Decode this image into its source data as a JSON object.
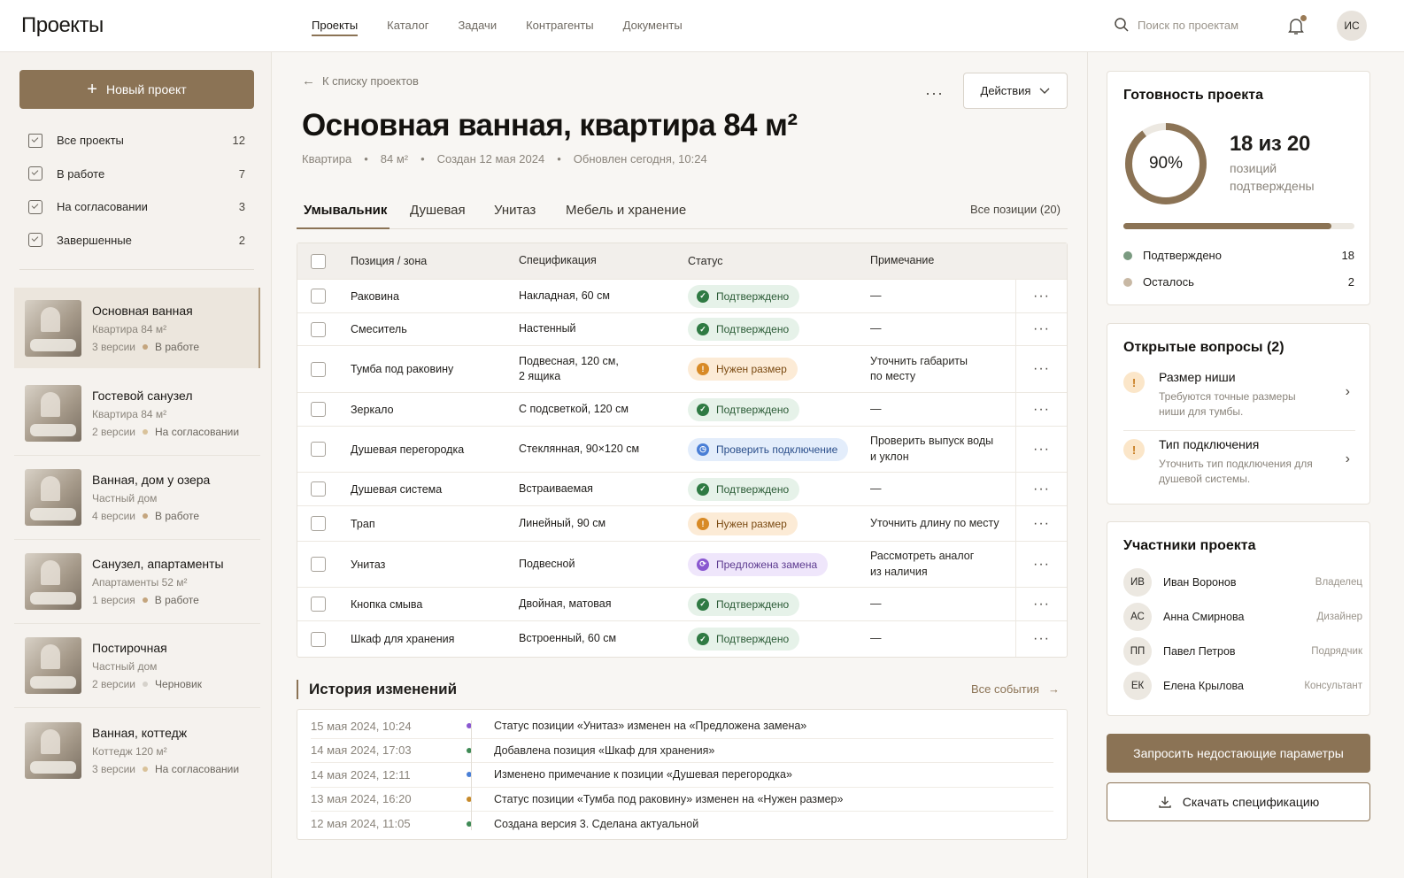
{
  "app": {
    "title": "Проекты"
  },
  "nav": [
    "Проекты",
    "Каталог",
    "Задачи",
    "Контрагенты",
    "Документы"
  ],
  "search": {
    "placeholder": "Поиск по проектам"
  },
  "user": {
    "initials": "ИС"
  },
  "sidebar": {
    "new_project": "Новый проект",
    "filters": [
      {
        "label": "Все проекты",
        "count": "12"
      },
      {
        "label": "В работе",
        "count": "7"
      },
      {
        "label": "На согласовании",
        "count": "3"
      },
      {
        "label": "Завершенные",
        "count": "2"
      }
    ],
    "projects": [
      {
        "name": "Основная ванная",
        "type": "Квартира 84 м²",
        "versions": "3 версии",
        "status": "В работе",
        "status_color": "#c4a57e"
      },
      {
        "name": "Гостевой санузел",
        "type": "Квартира 84 м²",
        "versions": "2 версии",
        "status": "На согласовании",
        "status_color": "#d9c29a"
      },
      {
        "name": "Ванная, дом у озера",
        "type": "Частный дом",
        "versions": "4 версии",
        "status": "В работе",
        "status_color": "#c4a57e"
      },
      {
        "name": "Санузел, апартаменты",
        "type": "Апартаменты 52 м²",
        "versions": "1 версия",
        "status": "В работе",
        "status_color": "#c4a57e"
      },
      {
        "name": "Постирочная",
        "type": "Частный дом",
        "versions": "2 версии",
        "status": "Черновик",
        "status_color": "#d6d2cb"
      },
      {
        "name": "Ванная, коттедж",
        "type": "Коттедж 120 м²",
        "versions": "3 версии",
        "status": "На согласовании",
        "status_color": "#d9c29a"
      }
    ]
  },
  "main": {
    "back": "К списку проектов",
    "actions": "Действия",
    "title": "Основная ванная, квартира 84 м²",
    "meta": [
      "Квартира",
      "•",
      "84 м²",
      "•",
      "Создан 12 мая 2024",
      "•",
      "Обновлен сегодня, 10:24"
    ],
    "tabs": [
      "Умывальник",
      "Душевая",
      "Унитаз",
      "Мебель и хранение"
    ],
    "all_positions": "Все позиции (20)",
    "table": {
      "headers": [
        "Позиция / зона",
        "Спецификация",
        "Статус",
        "Примечание"
      ],
      "rows": [
        {
          "name": "Раковина",
          "spec": "Накладная, 60 см",
          "status": "Подтверждено",
          "kind": "ok",
          "note": "—"
        },
        {
          "name": "Смеситель",
          "spec": "Настенный",
          "status": "Подтверждено",
          "kind": "ok",
          "note": "—"
        },
        {
          "name": "Тумба под раковину",
          "spec": "Подвесная, 120 см,\n2 ящика",
          "status": "Нужен размер",
          "kind": "warn",
          "note": "Уточнить габариты\nпо месту"
        },
        {
          "name": "Зеркало",
          "spec": "С подсветкой, 120 см",
          "status": "Подтверждено",
          "kind": "ok",
          "note": "—"
        },
        {
          "name": "Душевая перегородка",
          "spec": "Стеклянная, 90×120 см",
          "status": "Проверить подключение",
          "kind": "info",
          "note": "Проверить выпуск воды\nи уклон"
        },
        {
          "name": "Душевая система",
          "spec": "Встраиваемая",
          "status": "Подтверждено",
          "kind": "ok",
          "note": "—"
        },
        {
          "name": "Трап",
          "spec": "Линейный, 90 см",
          "status": "Нужен размер",
          "kind": "warn",
          "note": "Уточнить длину по месту"
        },
        {
          "name": "Унитаз",
          "spec": "Подвесной",
          "status": "Предложена замена",
          "kind": "alt",
          "note": "Рассмотреть аналог\nиз наличия"
        },
        {
          "name": "Кнопка смыва",
          "spec": "Двойная, матовая",
          "status": "Подтверждено",
          "kind": "ok",
          "note": "—"
        },
        {
          "name": "Шкаф для хранения",
          "spec": "Встроенный, 60 см",
          "status": "Подтверждено",
          "kind": "ok",
          "note": "—"
        }
      ]
    },
    "history": {
      "title": "История изменений",
      "all_events": "Все события",
      "events": [
        {
          "time": "15 мая 2024, 10:24",
          "text": "Статус позиции «Унитаз» изменен на «Предложена замена»",
          "color": "#8a58d0"
        },
        {
          "time": "14 мая 2024, 17:03",
          "text": "Добавлена позиция «Шкаф для хранения»",
          "color": "#3f8a55"
        },
        {
          "time": "14 мая 2024, 12:11",
          "text": "Изменено примечание к позиции «Душевая перегородка»",
          "color": "#4a7fd6"
        },
        {
          "time": "13 мая 2024, 16:20",
          "text": "Статус позиции «Тумба под раковину» изменен на «Нужен размер»",
          "color": "#c78a2a"
        },
        {
          "time": "12 мая 2024, 11:05",
          "text": "Создана версия 3. Сделана актуальной",
          "color": "#3f8a55"
        }
      ]
    }
  },
  "readiness": {
    "title": "Готовность проекта",
    "percent_label": "90%",
    "percent": 0.9,
    "count": "18 из 20",
    "sub": "позиций подтверждены",
    "legend": [
      {
        "label": "Подтверждено",
        "value": "18",
        "color": "#7a9a80"
      },
      {
        "label": "Осталось",
        "value": "2",
        "color": "#c8b8a4"
      }
    ]
  },
  "questions": {
    "title": "Открытые вопросы (2)",
    "items": [
      {
        "title": "Размер ниши",
        "desc": "Требуются точные размеры ниши для тумбы."
      },
      {
        "title": "Тип подключения",
        "desc": "Уточнить тип подключения для душевой системы."
      }
    ]
  },
  "members": {
    "title": "Участники проекта",
    "items": [
      {
        "initials": "ИВ",
        "name": "Иван Воронов",
        "role": "Владелец"
      },
      {
        "initials": "АС",
        "name": "Анна Смирнова",
        "role": "Дизайнер"
      },
      {
        "initials": "ПП",
        "name": "Павел Петров",
        "role": "Подрядчик"
      },
      {
        "initials": "ЕК",
        "name": "Елена Крылова",
        "role": "Консультант"
      }
    ]
  },
  "buttons": {
    "request": "Запросить недостающие параметры",
    "download": "Скачать спецификацию"
  }
}
